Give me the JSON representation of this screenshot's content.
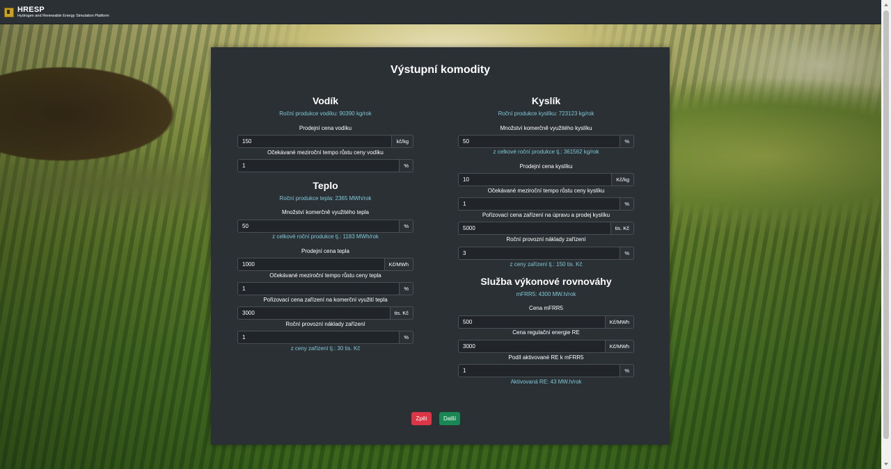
{
  "brand": {
    "name": "HRESP",
    "subtitle": "Hydrogen and Renewable Energy Simulation Platform"
  },
  "title": "Výstupní komodity",
  "vodik": {
    "heading": "Vodík",
    "production": "Roční produkce vodíku: 90390 kg/rok",
    "price_label": "Prodejní cena vodíku",
    "price_value": "150",
    "price_unit": "kč/kg",
    "growth_label": "Očekávané meziroční tempo růstu ceny vodíku",
    "growth_value": "1",
    "growth_unit": "%"
  },
  "teplo": {
    "heading": "Teplo",
    "production": "Roční produkce tepla: 2365 MWh/rok",
    "usage_label": "Množství komerčně využitého tepla",
    "usage_value": "50",
    "usage_unit": "%",
    "usage_info": "z celkové roční produkce tj.: 1183 MWh/rok",
    "price_label": "Prodejní cena tepla",
    "price_value": "1000",
    "price_unit": "Kč/MWh",
    "growth_label": "Očekávané meziroční tempo růstu ceny tepla",
    "growth_value": "1",
    "growth_unit": "%",
    "capex_label": "Pořizovací cena zařízení na komerční využití tepla",
    "capex_value": "3000",
    "capex_unit": "tis. Kč",
    "opex_label": "Roční provozní náklady zařízení",
    "opex_value": "1",
    "opex_unit": "%",
    "opex_info": "z ceny zařízení tj.: 30 tis. Kč"
  },
  "kyslik": {
    "heading": "Kyslík",
    "production": "Roční produkce kyslíku: 723123 kg/rok",
    "usage_label": "Množství komerčně využitého kyslíku",
    "usage_value": "50",
    "usage_unit": "%",
    "usage_info": "z celkové roční produkce tj.: 361562 kg/rok",
    "price_label": "Prodejní cena kyslíku",
    "price_value": "10",
    "price_unit": "Kč/kg",
    "growth_label": "Očekávané meziroční tempo růstu ceny kyslíku",
    "growth_value": "1",
    "growth_unit": "%",
    "capex_label": "Pořizovací cena zařízení na úpravu a prodej kyslíku",
    "capex_value": "5000",
    "capex_unit": "tis. Kč",
    "opex_label": "Roční provozní náklady zařízení",
    "opex_value": "3",
    "opex_unit": "%",
    "opex_info": "z ceny zařízení tj.: 150 tis. Kč"
  },
  "sluzba": {
    "heading": "Služba výkonové rovnováhy",
    "info": "mFRR5: 4300 MW.h/rok",
    "mfrr_label": "Cena mFRR5",
    "mfrr_value": "500",
    "mfrr_unit": "Kč/MWh",
    "re_label": "Cena regulační energie RE",
    "re_value": "3000",
    "re_unit": "Kč/MWh",
    "share_label": "Podíl aktivované RE k mFRR5",
    "share_value": "1",
    "share_unit": "%",
    "share_info": "Aktivovaná RE: 43 MW.h/rok"
  },
  "buttons": {
    "back": "Zpět",
    "next": "Další"
  },
  "colors": {
    "info_text": "#7fc8d8",
    "back_button": "#dc3545",
    "next_button": "#198754",
    "panel_bg": "#2b3035"
  }
}
